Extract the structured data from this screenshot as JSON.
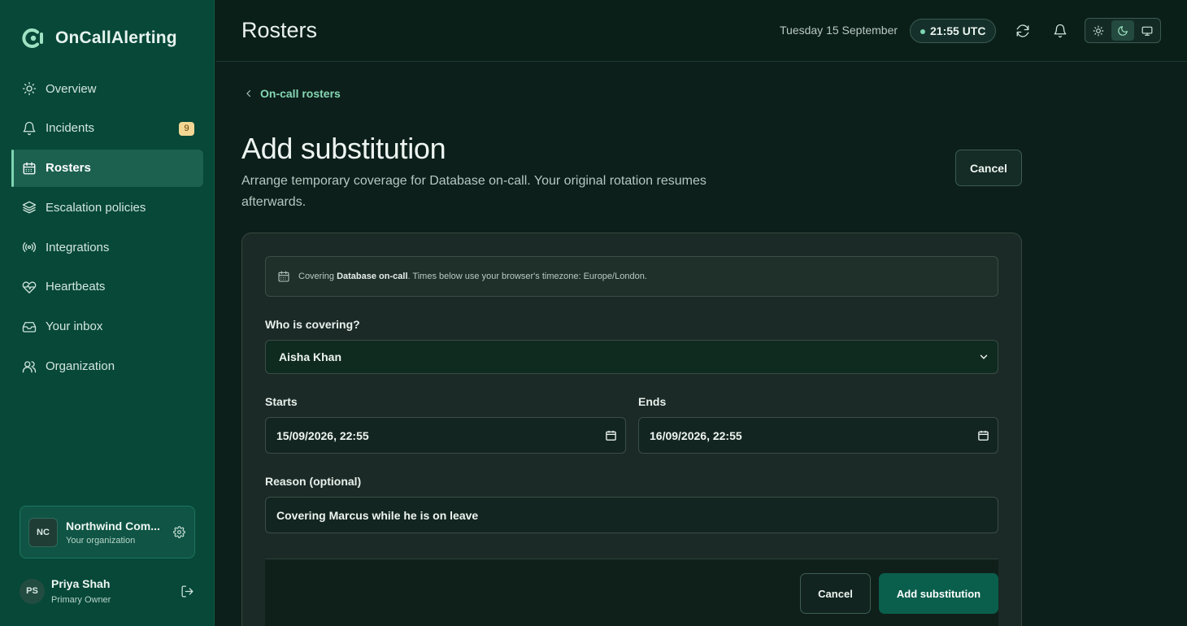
{
  "app": {
    "name": "OnCallAlerting"
  },
  "sidebar": {
    "items": [
      {
        "label": "Overview",
        "icon": "sun-icon"
      },
      {
        "label": "Incidents",
        "icon": "bell-icon",
        "badge": "9"
      },
      {
        "label": "Rosters",
        "icon": "calendar-icon",
        "active": true
      },
      {
        "label": "Escalation policies",
        "icon": "layers-icon"
      },
      {
        "label": "Integrations",
        "icon": "broadcast-icon"
      },
      {
        "label": "Heartbeats",
        "icon": "heart-pulse-icon"
      },
      {
        "label": "Your inbox",
        "icon": "inbox-icon"
      },
      {
        "label": "Organization",
        "icon": "users-icon"
      }
    ],
    "org": {
      "initials": "NC",
      "name": "Northwind Com...",
      "subtitle": "Your organization"
    },
    "user": {
      "initials": "PS",
      "name": "Priya Shah",
      "role": "Primary Owner"
    }
  },
  "header": {
    "title": "Rosters",
    "date": "Tuesday 15 September",
    "time": "21:55 UTC",
    "theme": {
      "options": [
        "light",
        "dark",
        "system"
      ],
      "selected": "dark"
    }
  },
  "main": {
    "breadcrumb": "On-call rosters",
    "title": "Add substitution",
    "description": "Arrange temporary coverage for Database on-call. Your original rotation resumes afterwards.",
    "cancel_label": "Cancel",
    "info": {
      "prefix": "Covering ",
      "roster": "Database on-call",
      "suffix": ". Times below use your browser's timezone: Europe/London."
    },
    "form": {
      "who_label": "Who is covering?",
      "who_value": "Aisha Khan",
      "starts_label": "Starts",
      "starts_value": "15/09/2026, 22:55",
      "ends_label": "Ends",
      "ends_value": "16/09/2026, 22:55",
      "reason_label": "Reason (optional)",
      "reason_value": "Covering Marcus while he is on leave"
    },
    "footer": {
      "cancel_label": "Cancel",
      "submit_label": "Add substitution"
    }
  },
  "colors": {
    "accent": "#7ed3b0",
    "sidebar": "#074838",
    "primary_button": "#0a5f4c",
    "badge": "#f3d694"
  }
}
